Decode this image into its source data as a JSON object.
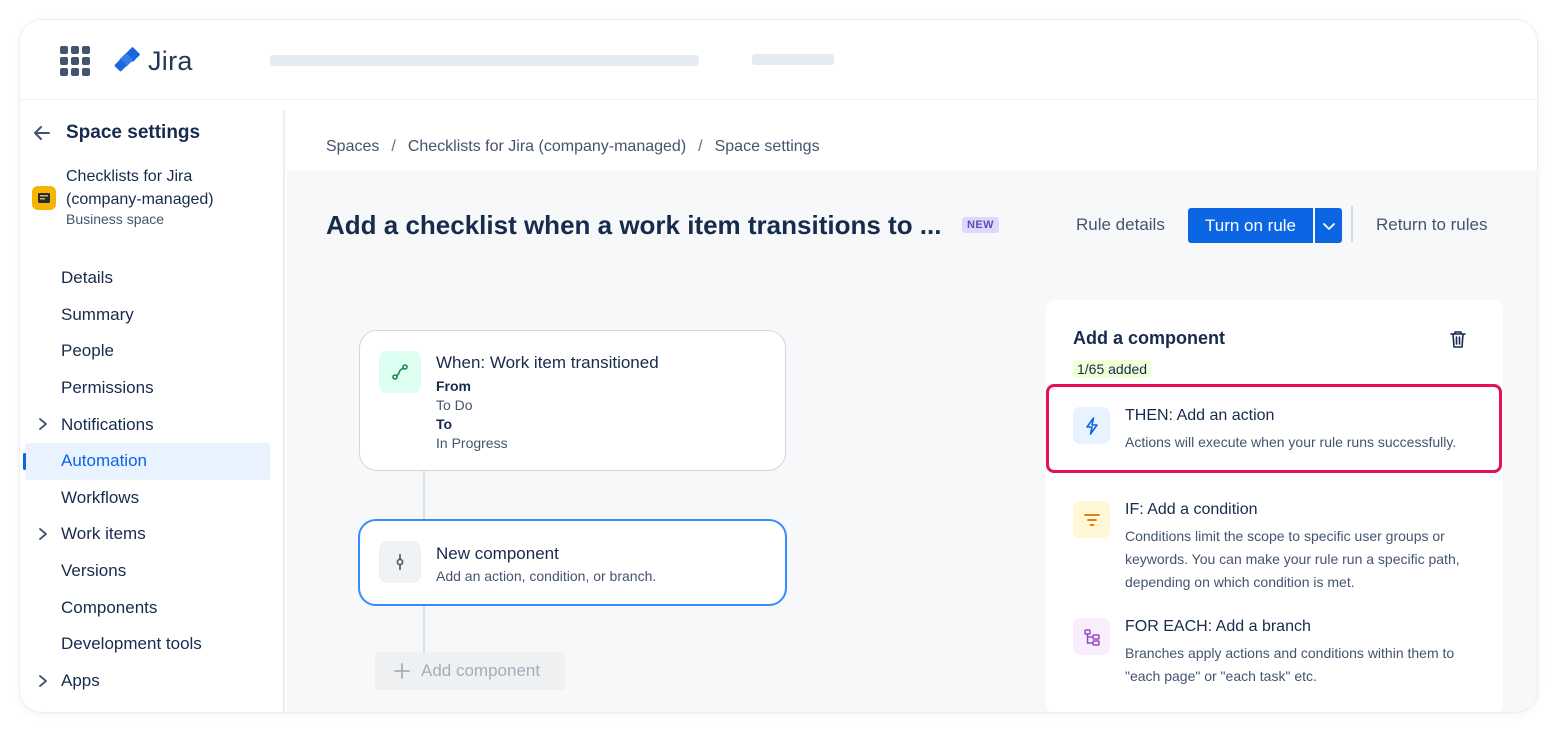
{
  "app": {
    "name": "Jira"
  },
  "sidebar": {
    "title": "Space settings",
    "space_name": "Checklists for Jira (company-managed)",
    "space_type": "Business space",
    "items": [
      {
        "label": "Details"
      },
      {
        "label": "Summary"
      },
      {
        "label": "People"
      },
      {
        "label": "Permissions"
      },
      {
        "label": "Notifications"
      },
      {
        "label": "Automation"
      },
      {
        "label": "Workflows"
      },
      {
        "label": "Work items"
      },
      {
        "label": "Versions"
      },
      {
        "label": "Components"
      },
      {
        "label": "Development tools"
      },
      {
        "label": "Apps"
      }
    ],
    "active_item": "Automation"
  },
  "breadcrumb": [
    "Spaces",
    "Checklists for Jira (company-managed)",
    "Space settings"
  ],
  "rule": {
    "title": "Add a checklist when a work item transitions to ...",
    "badge": "NEW",
    "rule_details_label": "Rule details",
    "turn_on_label": "Turn on rule",
    "return_label": "Return to rules"
  },
  "canvas": {
    "trigger": {
      "title": "When: Work item transitioned",
      "from_label": "From",
      "from_value": "To Do",
      "to_label": "To",
      "to_value": "In Progress"
    },
    "new_component": {
      "title": "New component",
      "subtitle": "Add an action, condition, or branch."
    },
    "add_component_label": "Add component"
  },
  "panel": {
    "title": "Add a component",
    "count": "1/65 added",
    "options": [
      {
        "title": "THEN: Add an action",
        "desc": "Actions will execute when your rule runs successfully.",
        "icon": "lightning-icon"
      },
      {
        "title": "IF: Add a condition",
        "desc": "Conditions limit the scope to specific user groups or keywords. You can make your rule run a specific path, depending on which condition is met.",
        "icon": "filter-icon"
      },
      {
        "title": "FOR EACH: Add a branch",
        "desc": "Branches apply actions and conditions within them to \"each page\" or \"each task\" etc.",
        "icon": "branch-icon"
      }
    ]
  },
  "colors": {
    "primary": "#0c66e4",
    "highlight": "#e2115a",
    "badge_new_bg": "#dfd8fd",
    "count_badge_bg": "#efffd6"
  }
}
